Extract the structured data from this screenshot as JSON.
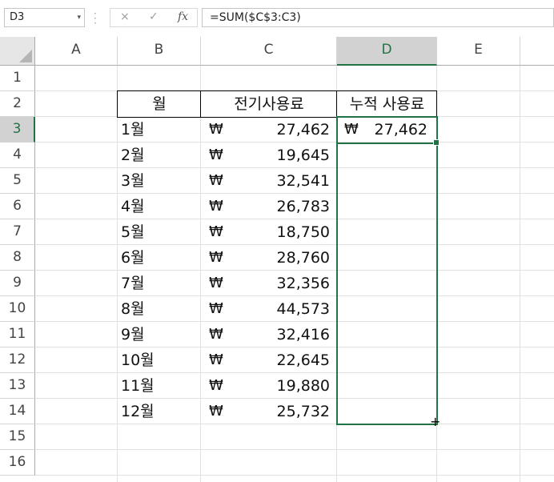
{
  "formula_bar": {
    "name_box": "D3",
    "name_box_dropdown": "▾",
    "cancel_icon": "×",
    "enter_icon": "✓",
    "fx_label": "fx",
    "formula": "=SUM($C$3:C3)"
  },
  "columns": [
    "A",
    "B",
    "C",
    "D",
    "E"
  ],
  "rows": [
    "1",
    "2",
    "3",
    "4",
    "5",
    "6",
    "7",
    "8",
    "9",
    "10",
    "11",
    "12",
    "13",
    "14",
    "15",
    "16"
  ],
  "table": {
    "headers": [
      "월",
      "전기사용료",
      "누적 사용료"
    ],
    "currency": "₩",
    "data": [
      {
        "month": "1월",
        "amount": "27,462"
      },
      {
        "month": "2월",
        "amount": "19,645"
      },
      {
        "month": "3월",
        "amount": "32,541"
      },
      {
        "month": "4월",
        "amount": "26,783"
      },
      {
        "month": "5월",
        "amount": "18,750"
      },
      {
        "month": "6월",
        "amount": "28,760"
      },
      {
        "month": "7월",
        "amount": "32,356"
      },
      {
        "month": "8월",
        "amount": "44,573"
      },
      {
        "month": "9월",
        "amount": "32,416"
      },
      {
        "month": "10월",
        "amount": "22,645"
      },
      {
        "month": "11월",
        "amount": "19,880"
      },
      {
        "month": "12월",
        "amount": "25,732"
      }
    ],
    "cumulative_d3": "27,462"
  },
  "selection": {
    "active_cell": "D3",
    "active_column": "D",
    "active_row": "3"
  },
  "colors": {
    "accent": "#217346"
  }
}
